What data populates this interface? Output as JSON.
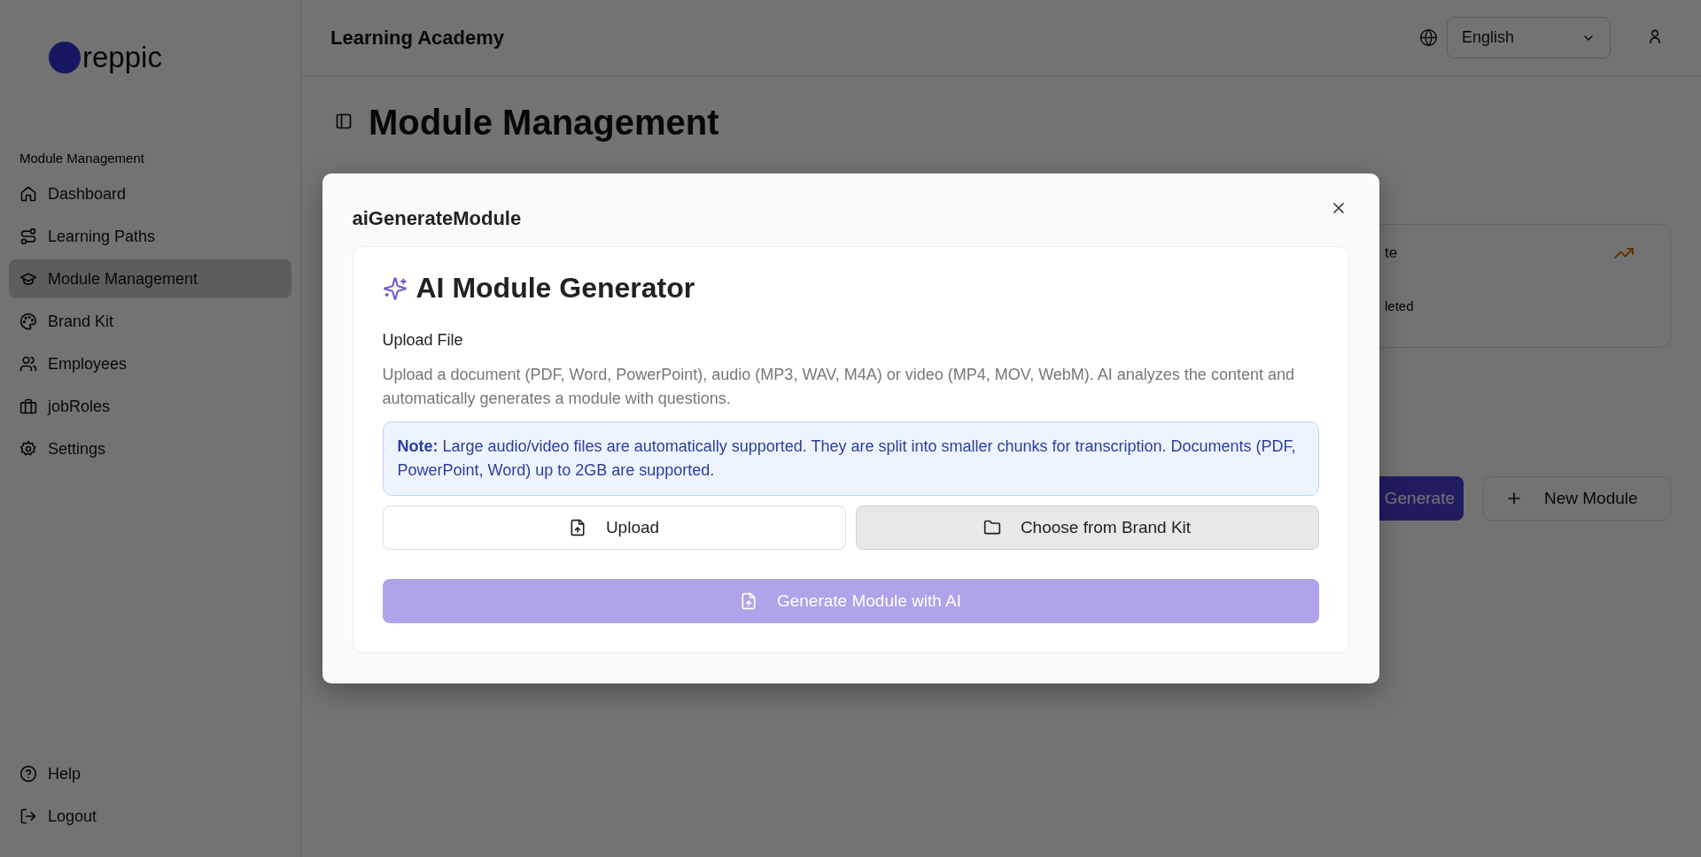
{
  "sidebar": {
    "logo": "reppic",
    "section_label": "Module Management",
    "items": [
      {
        "label": "Dashboard",
        "selected": false
      },
      {
        "label": "Learning Paths",
        "selected": false
      },
      {
        "label": "Module Management",
        "selected": true
      },
      {
        "label": "Brand Kit",
        "selected": false
      },
      {
        "label": "Employees",
        "selected": false
      },
      {
        "label": "jobRoles",
        "selected": false
      },
      {
        "label": "Settings",
        "selected": false
      }
    ],
    "footer_items": [
      {
        "label": "Help"
      },
      {
        "label": "Logout"
      }
    ]
  },
  "header": {
    "title": "Learning Academy",
    "language": "English"
  },
  "page": {
    "title": "Module Management",
    "stat_card": {
      "label": "te",
      "caption": "leted"
    },
    "actions": [
      {
        "label": "Generate",
        "kind": "primary"
      },
      {
        "label": "New Module",
        "kind": "outline"
      }
    ]
  },
  "dialog": {
    "title": "aiGenerateModule",
    "heading": "AI Module Generator",
    "section_label": "Upload File",
    "description": "Upload a document (PDF, Word, PowerPoint), audio (MP3, WAV, M4A) or video (MP4, MOV, WebM). AI analyzes the content and automatically generates a module with questions.",
    "note": "**Note:** Large audio/video files are automatically supported. They are split into smaller chunks for transcription. Documents (PDF, PowerPoint, Word) up to 2GB are supported.",
    "source_buttons": [
      {
        "label": "Upload",
        "hovered": false
      },
      {
        "label": "Choose from Brand Kit",
        "hovered": true
      }
    ],
    "generate_button": {
      "label": "Generate Module with AI",
      "disabled": true
    }
  }
}
